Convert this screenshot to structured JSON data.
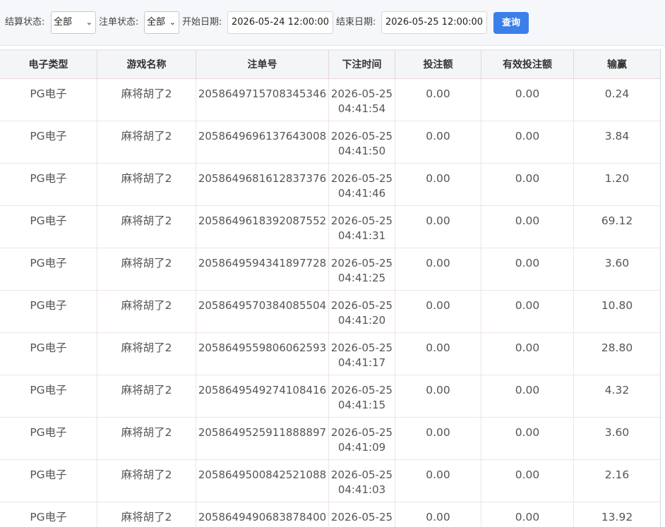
{
  "filters": {
    "settle_status_label": "结算状态:",
    "settle_status_value": "全部",
    "order_status_label": "注单状态:",
    "order_status_value": "全部",
    "start_date_label": "开始日期:",
    "start_date_value": "2026-05-24 12:00:00",
    "end_date_label": "结束日期:",
    "end_date_value": "2026-05-25 12:00:00",
    "query_button": "查询"
  },
  "table": {
    "columns": [
      "电子类型",
      "游戏名称",
      "注单号",
      "下注时间",
      "投注额",
      "有效投注额",
      "输赢"
    ],
    "rows": [
      {
        "type": "PG电子",
        "game": "麻将胡了2",
        "order_no": "2058649715708345346",
        "date": "2026-05-25",
        "time": "04:41:54",
        "bet": "0.00",
        "valid_bet": "0.00",
        "win_loss": "0.24"
      },
      {
        "type": "PG电子",
        "game": "麻将胡了2",
        "order_no": "2058649696137643008",
        "date": "2026-05-25",
        "time": "04:41:50",
        "bet": "0.00",
        "valid_bet": "0.00",
        "win_loss": "3.84"
      },
      {
        "type": "PG电子",
        "game": "麻将胡了2",
        "order_no": "2058649681612837376",
        "date": "2026-05-25",
        "time": "04:41:46",
        "bet": "0.00",
        "valid_bet": "0.00",
        "win_loss": "1.20"
      },
      {
        "type": "PG电子",
        "game": "麻将胡了2",
        "order_no": "2058649618392087552",
        "date": "2026-05-25",
        "time": "04:41:31",
        "bet": "0.00",
        "valid_bet": "0.00",
        "win_loss": "69.12"
      },
      {
        "type": "PG电子",
        "game": "麻将胡了2",
        "order_no": "2058649594341897728",
        "date": "2026-05-25",
        "time": "04:41:25",
        "bet": "0.00",
        "valid_bet": "0.00",
        "win_loss": "3.60"
      },
      {
        "type": "PG电子",
        "game": "麻将胡了2",
        "order_no": "2058649570384085504",
        "date": "2026-05-25",
        "time": "04:41:20",
        "bet": "0.00",
        "valid_bet": "0.00",
        "win_loss": "10.80"
      },
      {
        "type": "PG电子",
        "game": "麻将胡了2",
        "order_no": "2058649559806062593",
        "date": "2026-05-25",
        "time": "04:41:17",
        "bet": "0.00",
        "valid_bet": "0.00",
        "win_loss": "28.80"
      },
      {
        "type": "PG电子",
        "game": "麻将胡了2",
        "order_no": "2058649549274108416",
        "date": "2026-05-25",
        "time": "04:41:15",
        "bet": "0.00",
        "valid_bet": "0.00",
        "win_loss": "4.32"
      },
      {
        "type": "PG电子",
        "game": "麻将胡了2",
        "order_no": "2058649525911888897",
        "date": "2026-05-25",
        "time": "04:41:09",
        "bet": "0.00",
        "valid_bet": "0.00",
        "win_loss": "3.60"
      },
      {
        "type": "PG电子",
        "game": "麻将胡了2",
        "order_no": "2058649500842521088",
        "date": "2026-05-25",
        "time": "04:41:03",
        "bet": "0.00",
        "valid_bet": "0.00",
        "win_loss": "2.16"
      },
      {
        "type": "PG电子",
        "game": "麻将胡了2",
        "order_no": "2058649490683878400",
        "date": "2026-05-25",
        "time": "",
        "bet": "0.00",
        "valid_bet": "0.00",
        "win_loss": "13.92"
      }
    ]
  }
}
